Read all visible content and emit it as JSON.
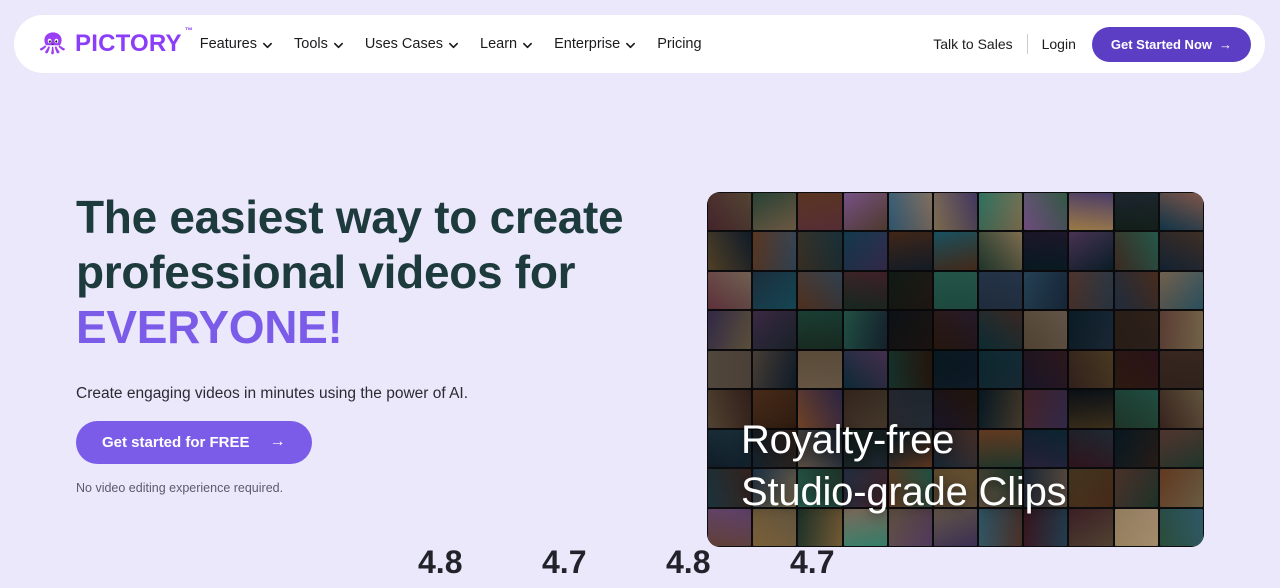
{
  "brand": {
    "name": "PICTORY",
    "trademark": "™",
    "logo_icon": "octopus-icon",
    "color": "#8b3dfa"
  },
  "nav": {
    "links": [
      {
        "label": "Features",
        "has_dropdown": true,
        "icon": "chevron-down-icon"
      },
      {
        "label": "Tools",
        "has_dropdown": true,
        "icon": "chevron-down-icon"
      },
      {
        "label": "Uses Cases",
        "has_dropdown": true,
        "icon": "chevron-down-icon"
      },
      {
        "label": "Learn",
        "has_dropdown": true,
        "icon": "chevron-down-icon"
      },
      {
        "label": "Enterprise",
        "has_dropdown": true,
        "icon": "chevron-down-icon"
      },
      {
        "label": "Pricing",
        "has_dropdown": false,
        "icon": ""
      }
    ],
    "talk_to_sales": "Talk to Sales",
    "login": "Login",
    "cta_label": "Get Started Now",
    "cta_arrow": "→",
    "cta_color": "#5b3ec4"
  },
  "hero": {
    "title_line1": "The easiest way to create",
    "title_line2": "professional videos for",
    "title_highlight": "EVERYONE!",
    "title_color": "#1d3a3c",
    "highlight_color": "#7b5ce8",
    "subtitle": "Create engaging videos in minutes using the power of AI.",
    "cta_label": "Get started for FREE",
    "cta_arrow": "→",
    "cta_color": "#7b5ce8",
    "note": "No video editing experience required."
  },
  "video": {
    "caption_line1": "Royalty-free",
    "caption_line2": "Studio-grade Clips"
  },
  "ratings": [
    {
      "score": "4.8"
    },
    {
      "score": "4.7"
    },
    {
      "score": "4.8"
    },
    {
      "score": "4.7"
    }
  ],
  "page": {
    "background_color": "#ece8fb"
  }
}
